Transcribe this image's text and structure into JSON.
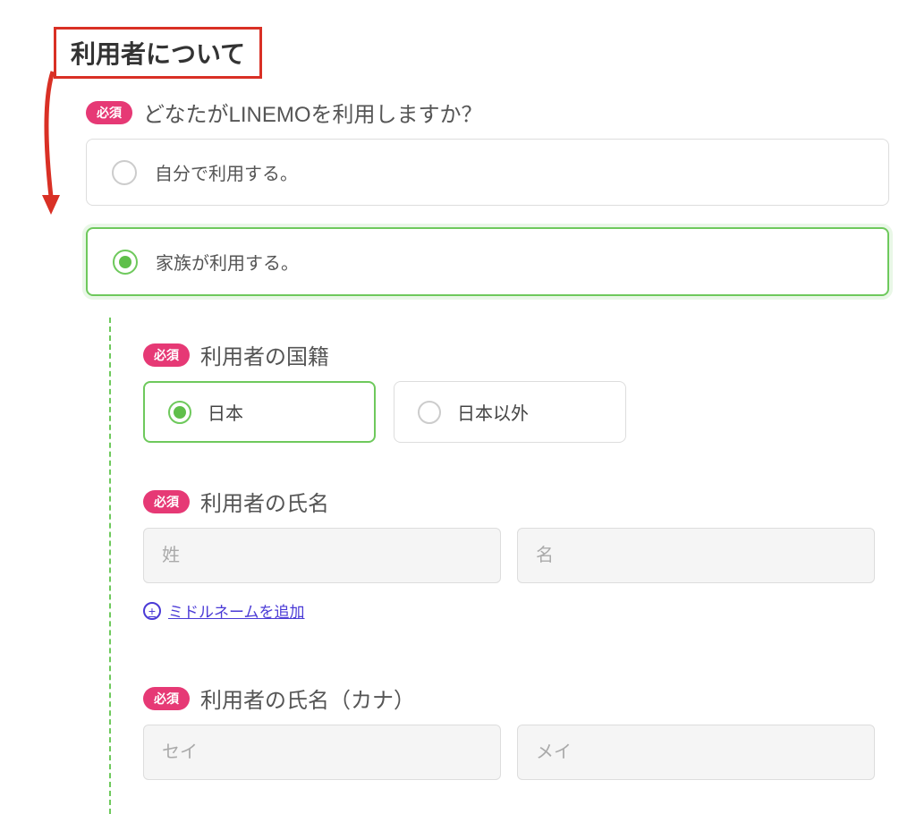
{
  "section": {
    "title": "利用者について"
  },
  "badges": {
    "required": "必須"
  },
  "userQuestion": {
    "label": "どなたがLINEMOを利用しますか？",
    "options": {
      "self": "自分で利用する。",
      "family": "家族が利用する。"
    }
  },
  "nationality": {
    "label": "利用者の国籍",
    "japan": "日本",
    "nonJapan": "日本以外"
  },
  "userName": {
    "label": "利用者の氏名",
    "placeholderLast": "姓",
    "placeholderFirst": "名"
  },
  "middleName": {
    "addLabel": "ミドルネームを追加"
  },
  "userNameKana": {
    "label": "利用者の氏名（カナ）",
    "placeholderLast": "セイ",
    "placeholderFirst": "メイ"
  }
}
